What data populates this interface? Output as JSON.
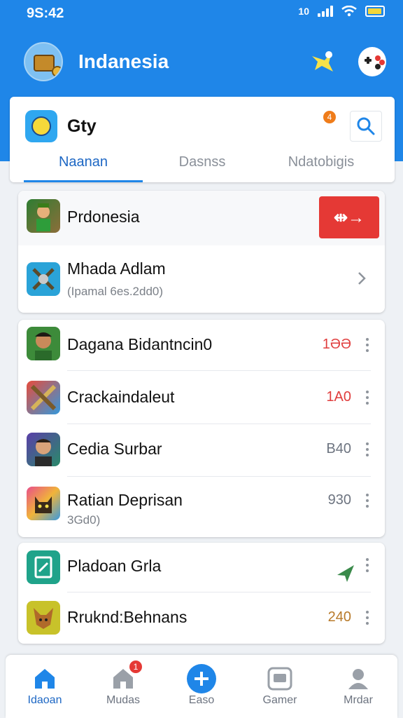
{
  "status_bar": {
    "time": "9S:42",
    "network": "10"
  },
  "header": {
    "title": "Indanesia"
  },
  "app_card": {
    "name": "Gty",
    "notification_count": "4",
    "tabs": [
      {
        "label": "Naanan",
        "active": true
      },
      {
        "label": "Dasnss",
        "active": false
      },
      {
        "label": "Ndatobigis",
        "active": false
      }
    ]
  },
  "featured": {
    "rows": [
      {
        "label": "Prdonesia",
        "action_label": "⇹→"
      },
      {
        "label": "Mhada Adlam",
        "sublabel": "(Ipamal 6es.2dd0)"
      }
    ]
  },
  "list_main": {
    "rows": [
      {
        "label": "Dagana Bidantncin0",
        "value": "1ƏƏ",
        "value_color": "#e03d3d"
      },
      {
        "label": "Crackaindaleut",
        "value": "1A0",
        "value_color": "#e03d3d"
      },
      {
        "label": "Cedia Surbar",
        "value": "B40"
      },
      {
        "label": "Ratian Deprisan",
        "sublabel": "3Gd0)",
        "value": "930"
      }
    ]
  },
  "list_secondary": {
    "rows": [
      {
        "label": "Pladoan Grla",
        "icon": "send-icon"
      },
      {
        "label": "Rruknd:Behnans",
        "value": "240",
        "value_color": "#b87a2a"
      }
    ]
  },
  "bottom_nav": [
    {
      "label": "Idaoan",
      "icon": "home-icon",
      "active": true
    },
    {
      "label": "Mudas",
      "icon": "store-icon",
      "badge": "1"
    },
    {
      "label": "Easo",
      "icon": "plus-icon"
    },
    {
      "label": "Gamer",
      "icon": "gamepad-icon"
    },
    {
      "label": "Mrdar",
      "icon": "profile-icon"
    }
  ],
  "colors": {
    "accent": "#1f86e8",
    "danger": "#e53935",
    "background": "#eef1f5"
  }
}
